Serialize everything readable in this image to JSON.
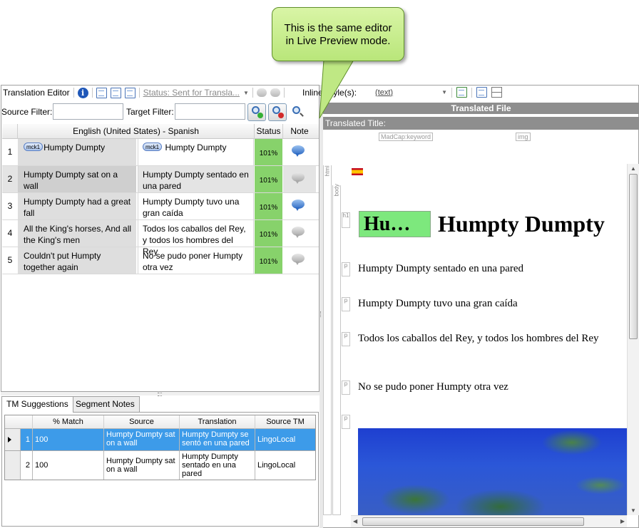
{
  "callout": {
    "text_line1": "This is the same editor",
    "text_line2": "in Live Preview mode."
  },
  "left_toolbar": {
    "title": "Translation Editor",
    "status_label": "Status: Sent for Transla..."
  },
  "filters": {
    "source_label": "Source Filter:",
    "target_label": "Target Filter:",
    "source_value": "",
    "target_value": ""
  },
  "grid": {
    "headers": {
      "num": "",
      "language": "English (United States) - Spanish",
      "status": "Status",
      "note": "Note"
    },
    "rows": [
      {
        "num": "1",
        "source_tag": "mck1",
        "source": "Humpty Dumpty",
        "target_tag": "mck1",
        "target": "Humpty Dumpty",
        "status": "101%",
        "note_icon": "blue-note-bubble-icon"
      },
      {
        "num": "2",
        "source": "Humpty Dumpty sat on a wall",
        "target": "Humpty Dumpty sentado en una pared",
        "status": "101%",
        "note_icon": "grey-note-bubble-icon"
      },
      {
        "num": "3",
        "source": "Humpty Dumpty had a great fall",
        "target": "Humpty Dumpty tuvo una gran caída",
        "status": "101%",
        "note_icon": "blue-note-bubble-icon"
      },
      {
        "num": "4",
        "source": "All the King's horses, And all the King's men",
        "target": "Todos los caballos del Rey, y todos los hombres del Rey",
        "status": "101%",
        "note_icon": "grey-note-bubble-icon"
      },
      {
        "num": "5",
        "source": "Couldn't put Humpty together again",
        "target": "No se pudo poner Humpty otra vez",
        "status": "101%",
        "note_icon": "grey-note-bubble-icon"
      }
    ]
  },
  "tabs": {
    "tm_suggestions": "TM Suggestions",
    "segment_notes": "Segment Notes"
  },
  "tm": {
    "headers": {
      "match": "% Match",
      "source": "Source",
      "translation": "Translation",
      "source_tm": "Source TM"
    },
    "rows": [
      {
        "num": "1",
        "match": "100",
        "source": "Humpty Dumpty sat on a wall",
        "translation": "Humpty Dumpty se sentó en una pared",
        "source_tm": "LingoLocal"
      },
      {
        "num": "2",
        "match": "100",
        "source": "Humpty Dumpty sat on a wall",
        "translation": "Humpty Dumpty sentado en una pared",
        "source_tm": "LingoLocal"
      }
    ]
  },
  "right_toolbar": {
    "inline_label": "Inline Style(s):",
    "inline_value": "(text)"
  },
  "preview": {
    "translated_file_bar": "Translated File",
    "translated_title_bar": "Translated Title:",
    "chip_keyword": "MadCap:keyword",
    "chip_img": "img",
    "tag_html": "html",
    "tag_body": "body",
    "tag_h1": "h1",
    "tag_p": "p",
    "keyword_text": "Hu…",
    "h1_text": "Humpty Dumpty",
    "p1": "Humpty Dumpty sentado en una pared",
    "p2": "Humpty Dumpty tuvo una gran caída",
    "p3": "Todos los caballos del Rey, y todos los hombres del Rey",
    "p4": "No se pudo poner Humpty otra vez"
  },
  "colors": {
    "status_green": "#87d26b",
    "highlight_blue": "#3d9be9",
    "callout_green": "#c9ee93",
    "keyword_green": "#7de87d"
  }
}
